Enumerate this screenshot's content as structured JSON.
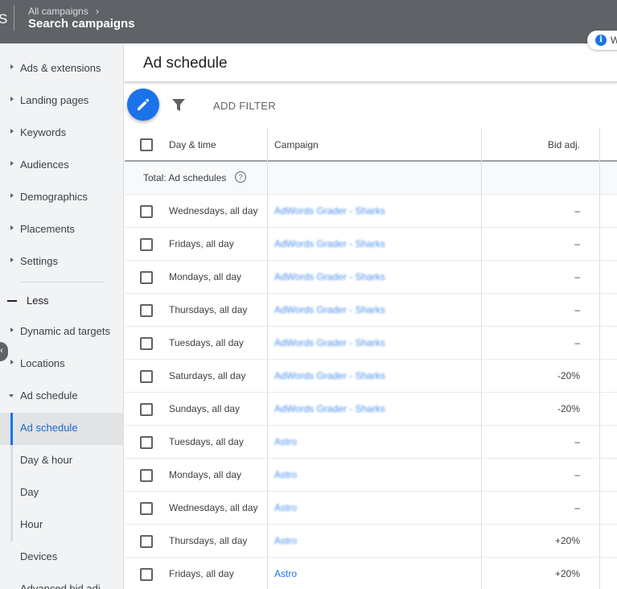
{
  "topbar": {
    "app_letter": "S",
    "breadcrumb": "All campaigns",
    "title": "Search campaigns",
    "info_chip_text": "W"
  },
  "sidebar": {
    "items": [
      {
        "label": "Ads & extensions"
      },
      {
        "label": "Landing pages"
      },
      {
        "label": "Keywords"
      },
      {
        "label": "Audiences"
      },
      {
        "label": "Demographics"
      },
      {
        "label": "Placements"
      },
      {
        "label": "Settings"
      }
    ],
    "less_label": "Less",
    "more_items": [
      {
        "label": "Dynamic ad targets"
      },
      {
        "label": "Locations"
      },
      {
        "label": "Ad schedule"
      }
    ],
    "sub_items": [
      {
        "label": "Ad schedule"
      },
      {
        "label": "Day & hour"
      },
      {
        "label": "Day"
      },
      {
        "label": "Hour"
      }
    ],
    "bottom_items": [
      {
        "label": "Devices"
      },
      {
        "label": "Advanced bid adj."
      }
    ]
  },
  "main": {
    "title": "Ad schedule",
    "add_filter": "ADD FILTER",
    "columns": {
      "day_time": "Day & time",
      "campaign": "Campaign",
      "bid_adj": "Bid adj."
    },
    "total_label": "Total: Ad schedules",
    "rows": [
      {
        "day": "Wednesdays, all day",
        "campaign": "AdWords Grader - Sharks",
        "bid": "–"
      },
      {
        "day": "Fridays, all day",
        "campaign": "AdWords Grader - Sharks",
        "bid": "–"
      },
      {
        "day": "Mondays, all day",
        "campaign": "AdWords Grader - Sharks",
        "bid": "–"
      },
      {
        "day": "Thursdays, all day",
        "campaign": "AdWords Grader - Sharks",
        "bid": "–"
      },
      {
        "day": "Tuesdays, all day",
        "campaign": "AdWords Grader - Sharks",
        "bid": "–"
      },
      {
        "day": "Saturdays, all day",
        "campaign": "AdWords Grader - Sharks",
        "bid": "-20%"
      },
      {
        "day": "Sundays, all day",
        "campaign": "AdWords Grader - Sharks",
        "bid": "-20%"
      },
      {
        "day": "Tuesdays, all day",
        "campaign": "Astro",
        "bid": "–"
      },
      {
        "day": "Mondays, all day",
        "campaign": "Astro",
        "bid": "–"
      },
      {
        "day": "Wednesdays, all day",
        "campaign": "Astro",
        "bid": "–"
      },
      {
        "day": "Thursdays, all day",
        "campaign": "Astro",
        "bid": "+20%"
      },
      {
        "day": "Fridays, all day",
        "campaign": "Astro",
        "bid": "+20%"
      }
    ]
  },
  "colors": {
    "topbar": "#5f6368",
    "accent": "#1a73e8",
    "sidebar_bg": "#f1f3f4"
  }
}
